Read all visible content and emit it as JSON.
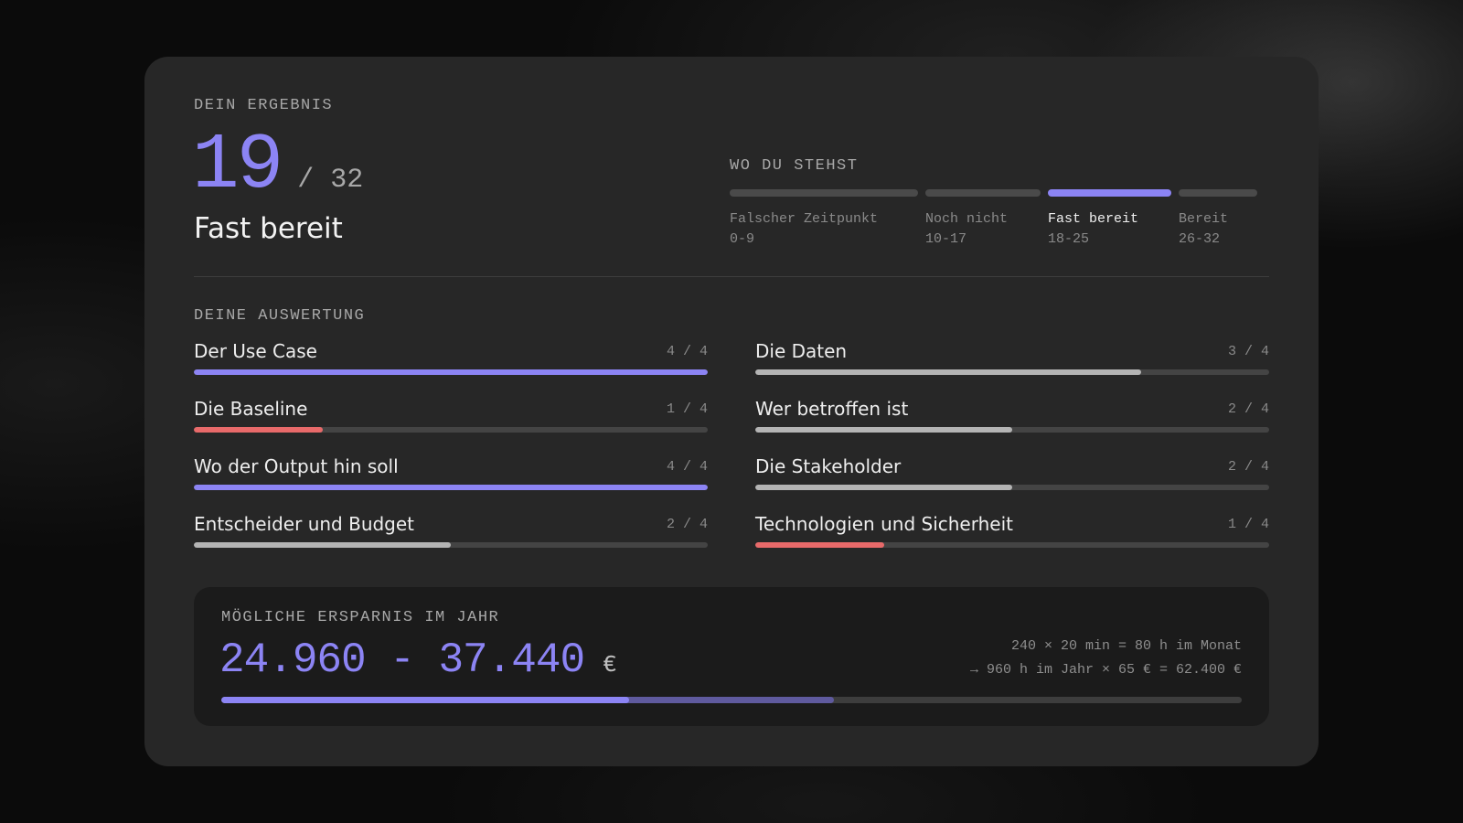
{
  "result": {
    "label": "DEIN ERGEBNIS",
    "score": "19",
    "max": "/ 32",
    "status": "Fast bereit"
  },
  "position": {
    "label": "WO DU STEHST",
    "segments": [
      {
        "name": "Falscher Zeitpunkt",
        "range": "0-9",
        "active": false
      },
      {
        "name": "Noch nicht",
        "range": "10-17",
        "active": false
      },
      {
        "name": "Fast bereit",
        "range": "18-25",
        "active": true
      },
      {
        "name": "Bereit",
        "range": "26-32",
        "active": false
      }
    ]
  },
  "evaluation": {
    "label": "DEINE AUSWERTUNG",
    "items": [
      {
        "title": "Der Use Case",
        "score": "4 / 4",
        "fraction": 1.0,
        "color": "#8c84f4"
      },
      {
        "title": "Die Daten",
        "score": "3 / 4",
        "fraction": 0.75,
        "color": "#b4b4b4"
      },
      {
        "title": "Die Baseline",
        "score": "1 / 4",
        "fraction": 0.25,
        "color": "#e86a6a"
      },
      {
        "title": "Wer betroffen ist",
        "score": "2 / 4",
        "fraction": 0.5,
        "color": "#b4b4b4"
      },
      {
        "title": "Wo der Output hin soll",
        "score": "4 / 4",
        "fraction": 1.0,
        "color": "#8c84f4"
      },
      {
        "title": "Die Stakeholder",
        "score": "2 / 4",
        "fraction": 0.5,
        "color": "#b4b4b4"
      },
      {
        "title": "Entscheider und Budget",
        "score": "2 / 4",
        "fraction": 0.5,
        "color": "#b4b4b4"
      },
      {
        "title": "Technologien und Sicherheit",
        "score": "1 / 4",
        "fraction": 0.25,
        "color": "#e86a6a"
      }
    ]
  },
  "savings": {
    "label": "MÖGLICHE ERSPARNIS IM JAHR",
    "value": "24.960 - 37.440",
    "currency": "€",
    "calc_line1": "240 × 20 min = 80 h im Monat",
    "calc_line2": "→ 960 h im Jahr × 65 € = 62.400 €",
    "bar_min_fraction": 0.4,
    "bar_max_fraction": 0.6
  },
  "colors": {
    "accent": "#8c84f4",
    "warning": "#e86a6a",
    "neutral": "#b4b4b4"
  }
}
